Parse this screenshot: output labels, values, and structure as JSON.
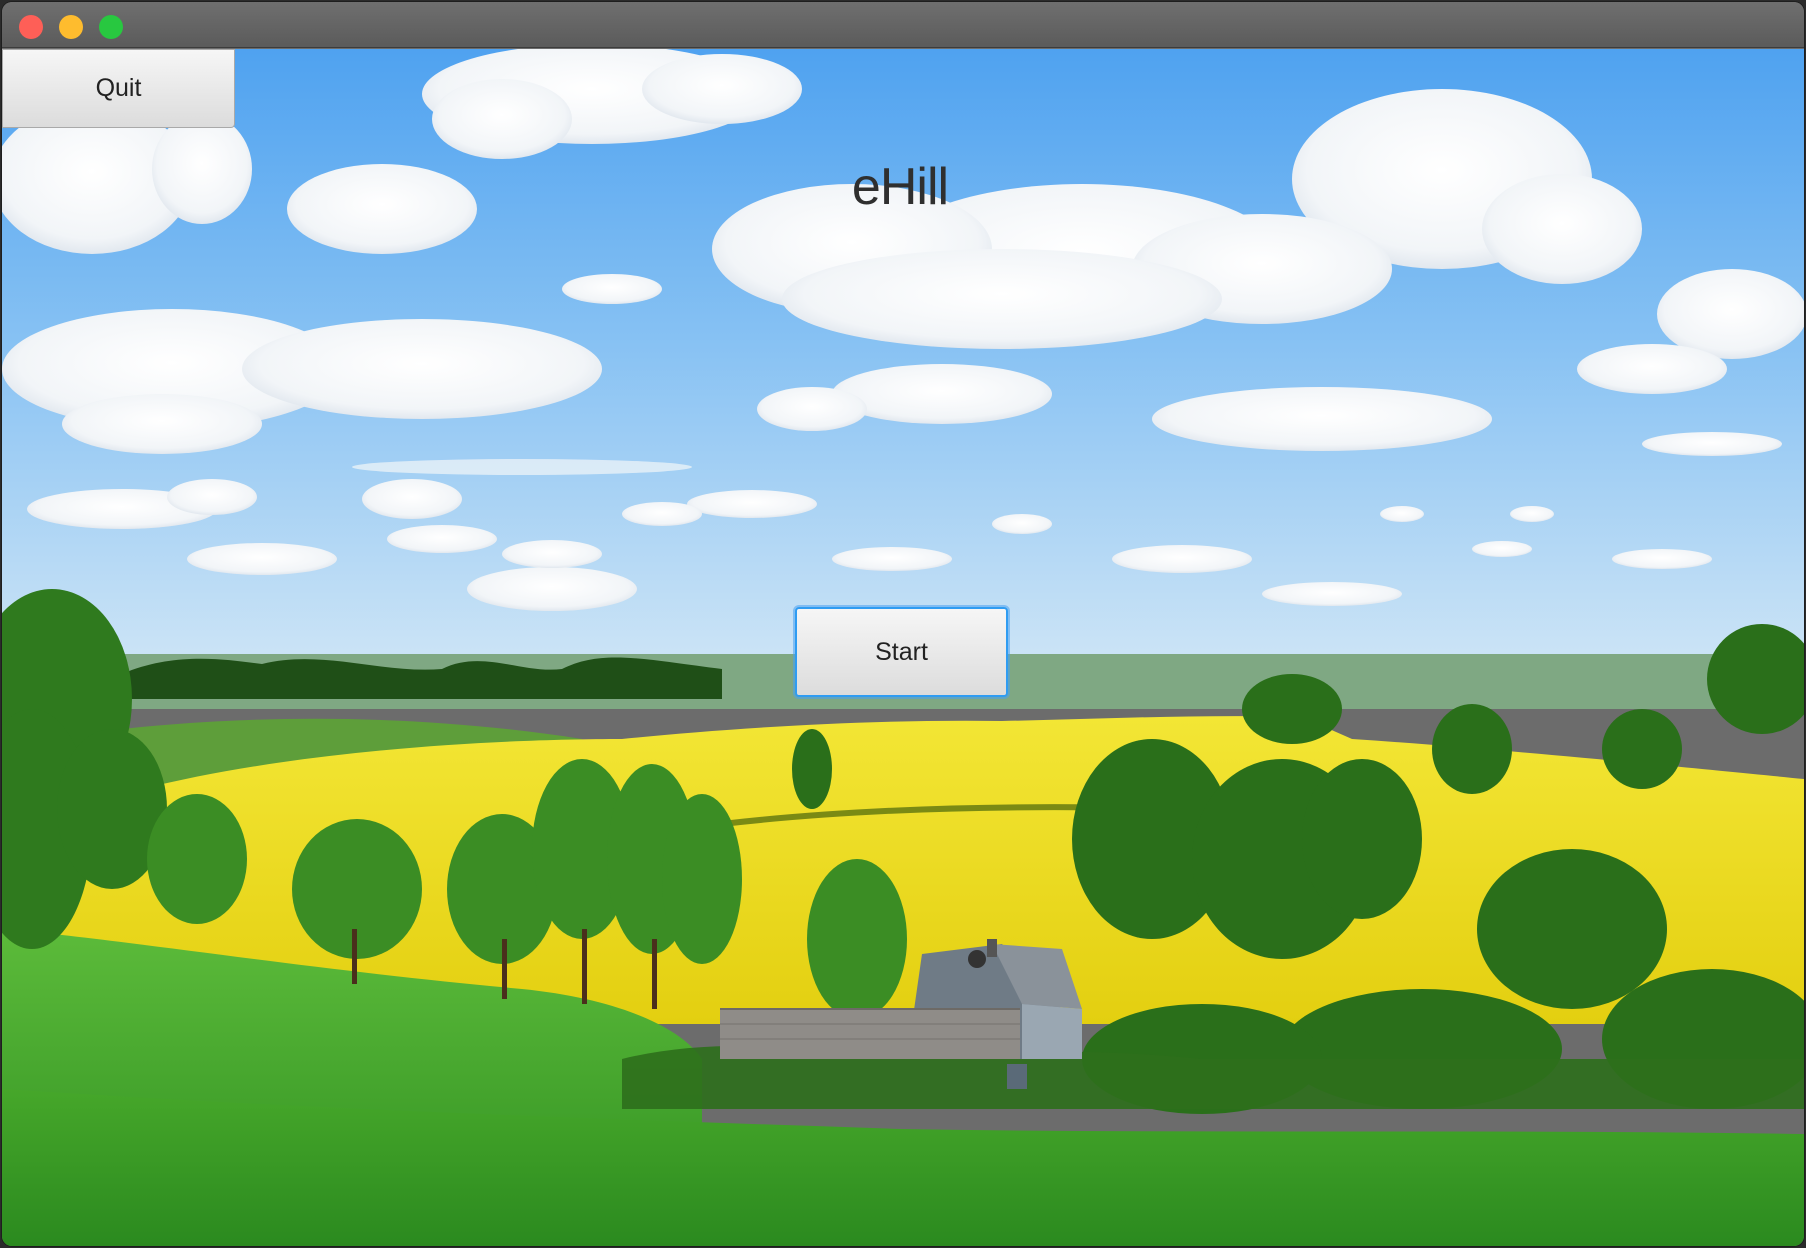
{
  "window": {
    "controls": [
      {
        "name": "close",
        "color": "#fe5f57"
      },
      {
        "name": "minimize",
        "color": "#febc2e"
      },
      {
        "name": "zoom",
        "color": "#28c840"
      }
    ]
  },
  "app": {
    "title": "eHill",
    "quit_label": "Quit",
    "start_label": "Start"
  },
  "background": {
    "description_icon": "landscape-photo",
    "colors": {
      "sky_top": "#59a7f2",
      "sky_bottom": "#c9e3f7",
      "rapeseed": "#f1e21d",
      "grass": "#3aa82a",
      "trees": "#2c6b1b"
    }
  }
}
